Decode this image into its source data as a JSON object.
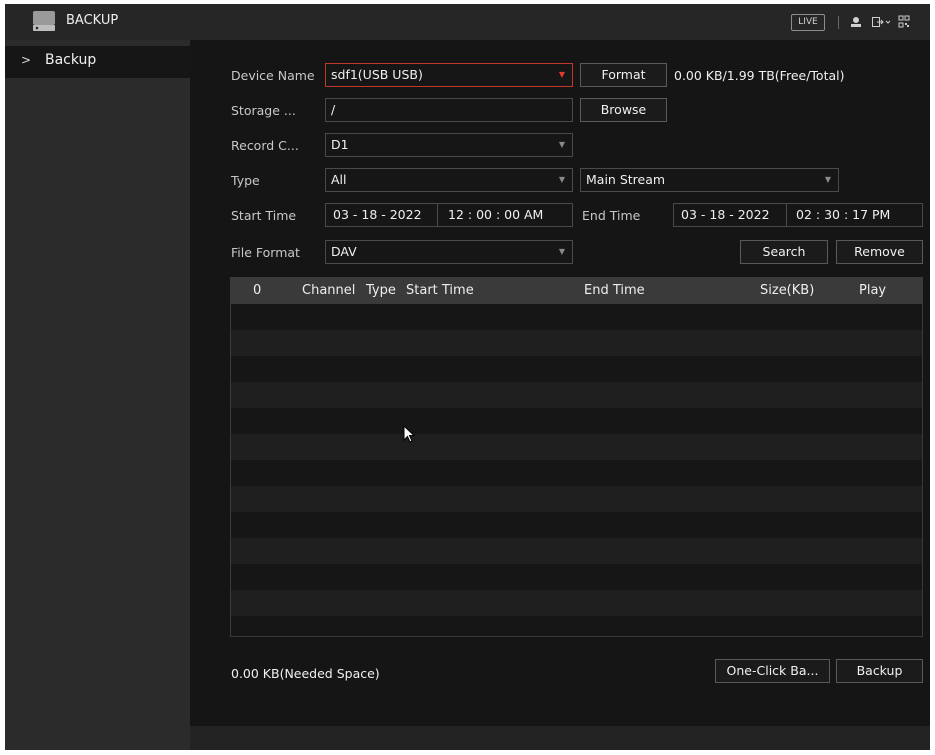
{
  "header": {
    "title": "BACKUP",
    "live_label": "LIVE",
    "icons": [
      "hdd-icon",
      "user-icon",
      "logout-icon",
      "qrcode-icon"
    ]
  },
  "sidebar": {
    "items": [
      {
        "label": "Backup",
        "arrow": ">"
      }
    ]
  },
  "form": {
    "device_name_label": "Device Name",
    "device_name_value": "sdf1(USB USB)",
    "format_button": "Format",
    "capacity_text": "0.00 KB/1.99 TB(Free/Total)",
    "storage_label": "Storage ...",
    "storage_value": "/",
    "browse_button": "Browse",
    "record_channel_label": "Record C...",
    "record_channel_value": "D1",
    "type_label": "Type",
    "type_value": "All",
    "stream_value": "Main Stream",
    "start_time_label": "Start Time",
    "start_date": "03 - 18 - 2022",
    "start_time": "12 : 00 : 00 AM",
    "end_time_label": "End Time",
    "end_date": "03 - 18 - 2022",
    "end_time": "02 : 30 : 17 PM",
    "file_format_label": "File Format",
    "file_format_value": "DAV",
    "search_button": "Search",
    "remove_button": "Remove"
  },
  "table": {
    "columns": [
      "0",
      "Channel",
      "Type",
      "Start Time",
      "End Time",
      "Size(KB)",
      "Play"
    ],
    "rows": []
  },
  "footer": {
    "needed_space": "0.00 KB(Needed Space)",
    "one_click_button": "One-Click Ba...",
    "backup_button": "Backup"
  },
  "colors": {
    "accent_red": "#c0392b",
    "background": "#151515",
    "sidebar": "#2b2b2b",
    "header": "#262626"
  }
}
